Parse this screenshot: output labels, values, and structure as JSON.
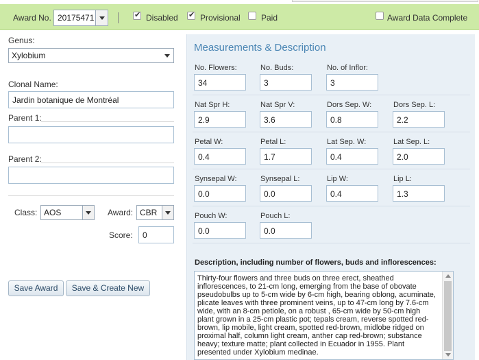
{
  "header": {
    "award_no_label": "Award No.",
    "award_no_value": "20175471",
    "disabled_label": "Disabled",
    "disabled_checked": true,
    "provisional_label": "Provisional",
    "provisional_checked": true,
    "paid_label": "Paid",
    "paid_checked": false,
    "award_data_complete_label": "Award Data Complete",
    "award_data_complete_checked": false
  },
  "form": {
    "genus_label": "Genus:",
    "genus_value": "Xylobium",
    "clonal_name_label": "Clonal Name:",
    "clonal_name_value": "Jardin botanique de Montréal",
    "parent1_label": "Parent 1:",
    "parent1_value": "",
    "parent2_label": "Parent 2:",
    "parent2_value": "",
    "class_label": "Class:",
    "class_value": "AOS",
    "award_label": "Award:",
    "award_value": "CBR",
    "score_label": "Score:",
    "score_value": "0"
  },
  "buttons": {
    "save_award": "Save Award",
    "save_create_new": "Save & Create New"
  },
  "measurements": {
    "title": "Measurements & Description",
    "rows": [
      [
        {
          "label": "No. Flowers:",
          "value": "34"
        },
        {
          "label": "No. Buds:",
          "value": "3"
        },
        {
          "label": "No. of Inflor:",
          "value": "3"
        }
      ],
      [
        {
          "label": "Nat Spr H:",
          "value": "2.9"
        },
        {
          "label": "Nat Spr V:",
          "value": "3.6"
        },
        {
          "label": "Dors Sep. W:",
          "value": "0.8"
        },
        {
          "label": "Dors Sep. L:",
          "value": "2.2"
        }
      ],
      [
        {
          "label": "Petal W:",
          "value": "0.4"
        },
        {
          "label": "Petal L:",
          "value": "1.7"
        },
        {
          "label": "Lat Sep. W:",
          "value": "0.4"
        },
        {
          "label": "Lat Sep. L:",
          "value": "2.0"
        }
      ],
      [
        {
          "label": "Synsepal W:",
          "value": "0.0"
        },
        {
          "label": "Synsepal L:",
          "value": "0.0"
        },
        {
          "label": "Lip W:",
          "value": "0.4"
        },
        {
          "label": "Lip L:",
          "value": "1.3"
        }
      ],
      [
        {
          "label": "Pouch W:",
          "value": "0.0"
        },
        {
          "label": "Pouch L:",
          "value": "0.0"
        }
      ]
    ]
  },
  "description": {
    "label": "Description, including number of flowers, buds and inflorescences:",
    "text": "Thirty-four flowers and three buds on three erect, sheathed inflorescences, to 21-cm long, emerging from the base of obovate pseudobulbs up to 5-cm wide by 6-cm high, bearing oblong, acuminate, plicate leaves with three prominent veins, up to 47-cm long by 7.6-cm wide, with an 8-cm petiole, on a robust , 65-cm wide by 50-cm high plant grown in a 25-cm plastic pot; tepals cream, reverse spotted red-brown, lip mobile, light cream, spotted red-brown, midlobe ridged on proximal half, column light cream, anther cap red-brown; substance heavy; texture matte; plant collected in Ecuador in 1955. Plant presented under Xylobium medinae."
  },
  "colors": {
    "header_bg": "#cdeaa6",
    "panel_bg": "#e9f0f6",
    "title_blue": "#4b86b4"
  }
}
